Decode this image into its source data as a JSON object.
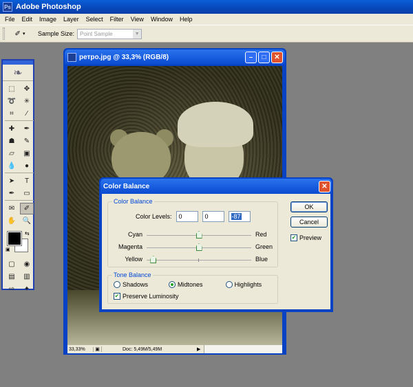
{
  "app": {
    "title": "Adobe Photoshop",
    "logo_text": "Ps"
  },
  "menu": [
    "File",
    "Edit",
    "Image",
    "Layer",
    "Select",
    "Filter",
    "View",
    "Window",
    "Help"
  ],
  "options": {
    "tool_icon": "eyedropper-icon",
    "sample_size_label": "Sample Size:",
    "sample_size_value": "Point Sample"
  },
  "document": {
    "title": "ретро.jpg @ 33,3% (RGB/8)",
    "zoom": "33,33%",
    "doc_info": "Doc: 5,49M/5,49M"
  },
  "dialog": {
    "title": "Color Balance",
    "color_balance_legend": "Color Balance",
    "color_levels_label": "Color Levels:",
    "levels": [
      "0",
      "0",
      "-87"
    ],
    "sliders": [
      {
        "left": "Cyan",
        "right": "Red",
        "value": 0
      },
      {
        "left": "Magenta",
        "right": "Green",
        "value": 0
      },
      {
        "left": "Yellow",
        "right": "Blue",
        "value": -87
      }
    ],
    "tone_balance_legend": "Tone Balance",
    "tones": [
      "Shadows",
      "Midtones",
      "Highlights"
    ],
    "selected_tone": "Midtones",
    "preserve_label": "Preserve Luminosity",
    "preserve_checked": true,
    "ok_label": "OK",
    "cancel_label": "Cancel",
    "preview_label": "Preview",
    "preview_checked": true
  },
  "colors": {
    "titlebar": "#0a4ad0",
    "dialog_bg": "#ece9d8",
    "legend": "#0046d5",
    "canvas_bg": "#808080"
  }
}
